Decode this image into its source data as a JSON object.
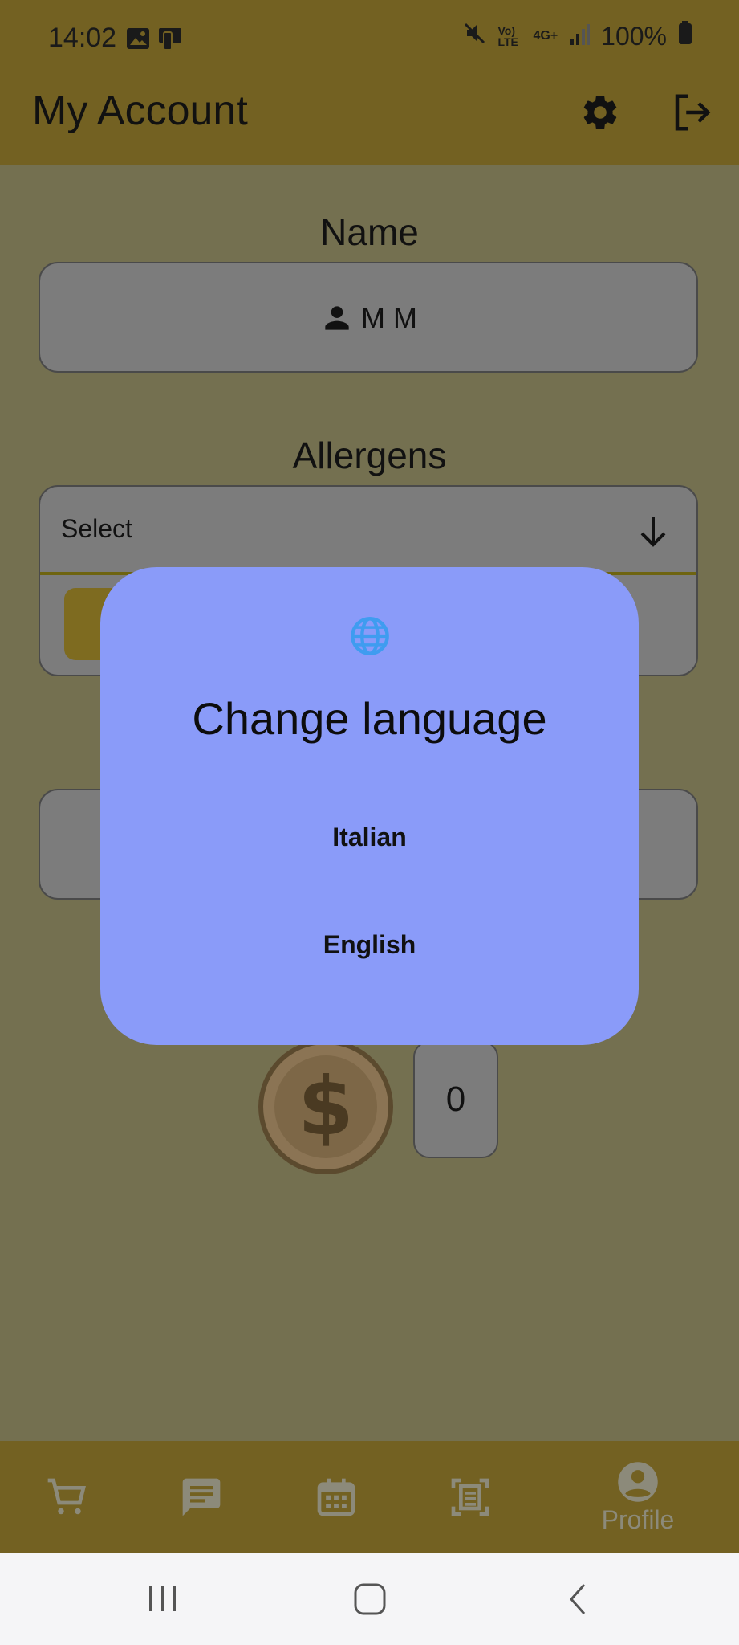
{
  "status_bar": {
    "time": "14:02",
    "network_label": "Vo) LTE",
    "network_gen": "4G+",
    "battery": "100%"
  },
  "app_bar": {
    "title": "My Account",
    "settings_icon": "gear-icon",
    "logout_icon": "logout-icon"
  },
  "name_section": {
    "label": "Name",
    "value": "M M",
    "icon": "person-icon"
  },
  "allergens_section": {
    "label": "Allergens",
    "select_placeholder": "Select",
    "icon": "arrow-down-icon"
  },
  "points_section": {
    "value": "0",
    "icon": "coin-dollar-icon"
  },
  "dialog": {
    "icon": "globe-icon",
    "title": "Change language",
    "options": [
      {
        "label": "Italian"
      },
      {
        "label": "English"
      }
    ]
  },
  "bottom_nav": {
    "items": [
      {
        "icon": "cart-icon"
      },
      {
        "icon": "chat-icon"
      },
      {
        "icon": "calendar-icon"
      },
      {
        "icon": "scan-icon"
      },
      {
        "icon": "account-circle-icon",
        "label": "Profile"
      }
    ]
  },
  "colors": {
    "app_bar": "#736122",
    "scrim_background": "#747050",
    "dialog_background": "#8a9bf9",
    "globe_icon": "#3f9cf0"
  }
}
